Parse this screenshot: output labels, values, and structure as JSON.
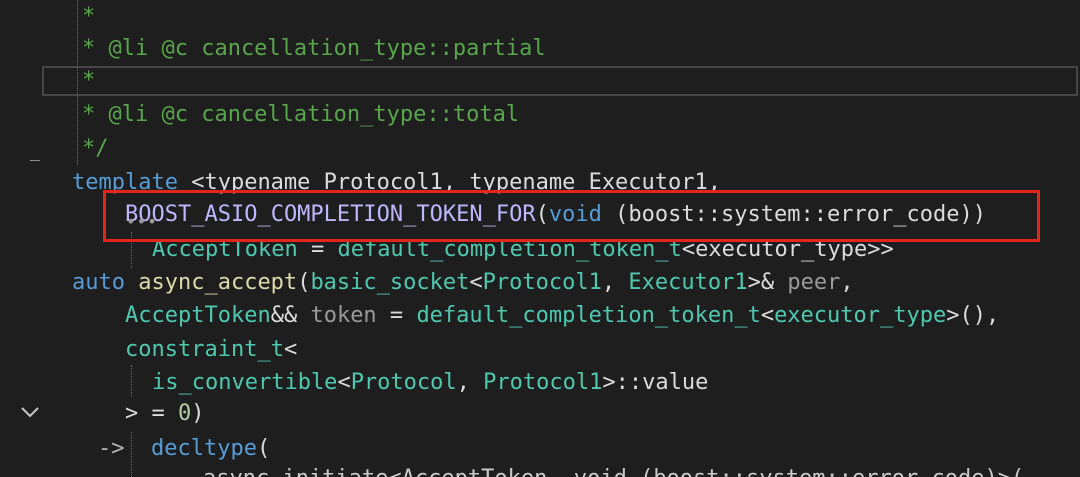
{
  "editor": {
    "lines": [
      {
        "t1": "*"
      },
      {
        "t1": "* @li @c cancellation_type::partial"
      },
      {
        "t1": "*"
      },
      {
        "t1": "* @li @c cancellation_type::total"
      },
      {
        "t1": "*/"
      }
    ],
    "template_line": {
      "kw": "template",
      "rest": " <typename Protocol1, typename Executor1,"
    },
    "macro_line": {
      "macro": "BOOST_ASIO_COMPLETION_TOKEN_FOR",
      "open": "(",
      "kw": "void",
      "args": " (boost::system::error_code))"
    },
    "accept_line": {
      "type": "AcceptToken",
      "eq": " = ",
      "fn": "default_completion_token_t",
      "tail": "<executor_type>>"
    },
    "auto_line": {
      "kw": "auto",
      "fn": "async_accept",
      "p1": "(",
      "t1": "basic_socket",
      "p2": "<",
      "t2": "Protocol1",
      "p3": ", ",
      "t3": "Executor1",
      "p4": ">& ",
      "param": "peer",
      "p5": ","
    },
    "token_line": {
      "type": "AcceptToken",
      "p1": "&& ",
      "param": "token",
      "p2": " = ",
      "fn": "default_completion_token_t",
      "p3": "<",
      "t2": "executor_type",
      "p4": ">(),"
    },
    "constraint_line": {
      "type": "constraint_t",
      "p1": "<"
    },
    "convertible_line": {
      "type": "is_convertible",
      "p1": "<",
      "t1": "Protocol",
      "p2": ", ",
      "t2": "Protocol1",
      "p3": ">::value"
    },
    "close_line": {
      "p1": "> = ",
      "num": "0",
      "p2": ")"
    },
    "decltype_line": {
      "arrow": "->",
      "kw": "decltype",
      "p1": "("
    },
    "last_line": {
      "text": "    async_initiate<AcceptToken, void (boost::system::error_code)>("
    },
    "ellipsis": "•••"
  },
  "colors": {
    "background": "#1e1e1e",
    "comment": "#57a64a",
    "keyword": "#569cd6",
    "type": "#4ec9b0",
    "function": "#dcdcaa",
    "macro": "#beb7ff",
    "highlight_box": "#e3261b"
  },
  "icons": {
    "fold": "chevron-down-icon"
  }
}
